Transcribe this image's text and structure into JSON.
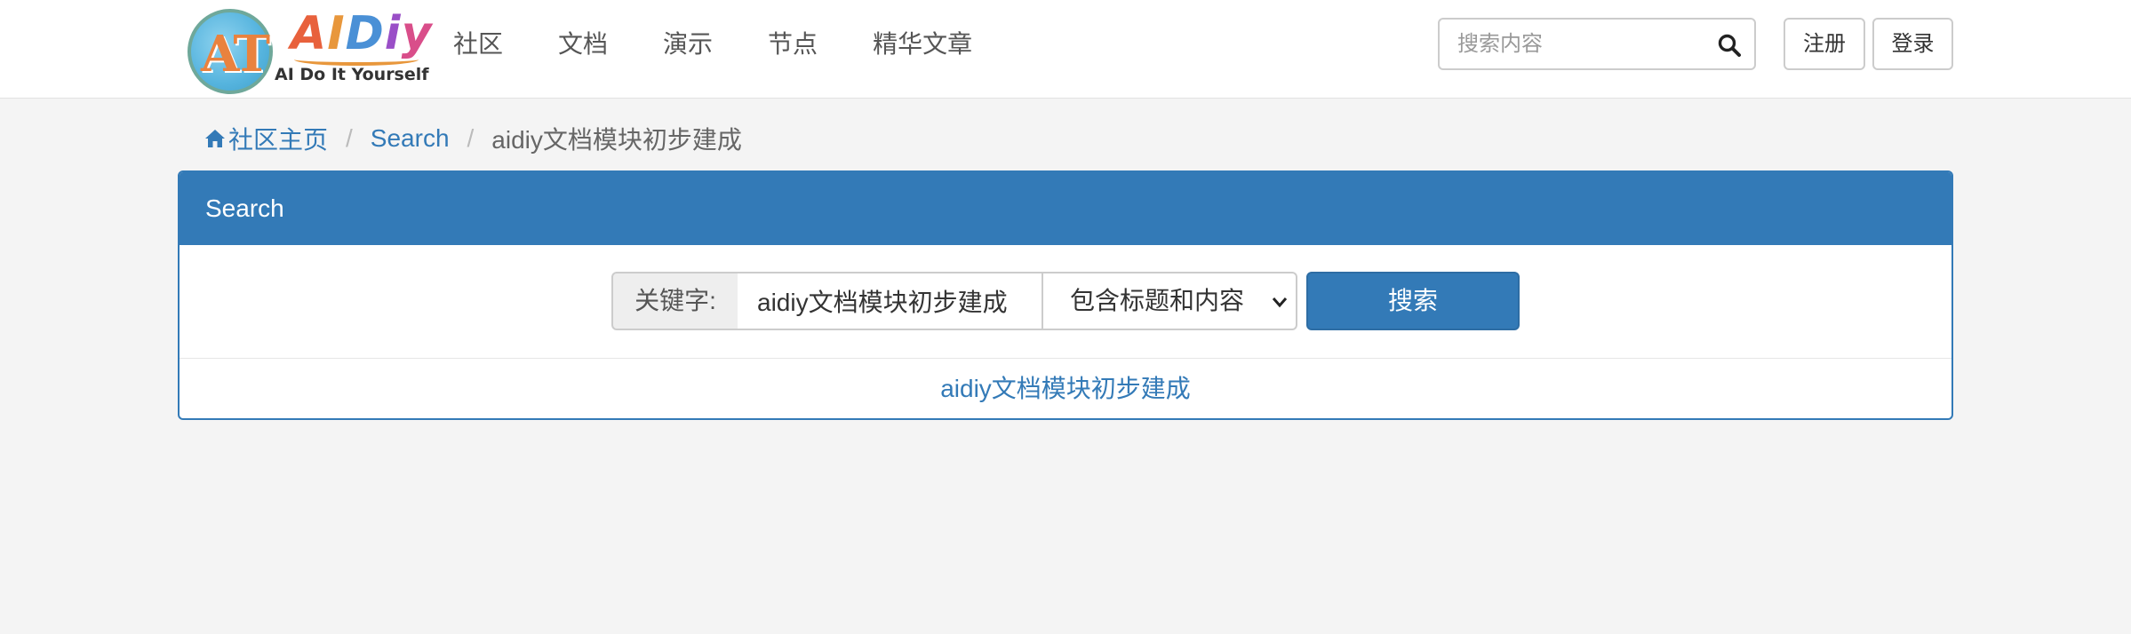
{
  "logo": {
    "circle_text": "AT",
    "word": [
      "A",
      "I",
      "D",
      "i",
      "y"
    ],
    "tagline": "AI Do It Yourself"
  },
  "nav": {
    "items": [
      "社区",
      "文档",
      "演示",
      "节点",
      "精华文章"
    ]
  },
  "search": {
    "placeholder": "搜索内容",
    "icon": "search-icon"
  },
  "auth": {
    "register": "注册",
    "login": "登录"
  },
  "breadcrumb": {
    "home": "社区主页",
    "home_icon": "home-icon",
    "search": "Search",
    "current": "aidiy文档模块初步建成"
  },
  "panel": {
    "title": "Search",
    "keyword_label": "关键字:",
    "keyword_value": "aidiy文档模块初步建成",
    "scope_selected": "包含标题和内容",
    "submit_label": "搜索",
    "result": "aidiy文档模块初步建成"
  },
  "colors": {
    "primary": "#337ab7",
    "background": "#f4f4f4"
  }
}
